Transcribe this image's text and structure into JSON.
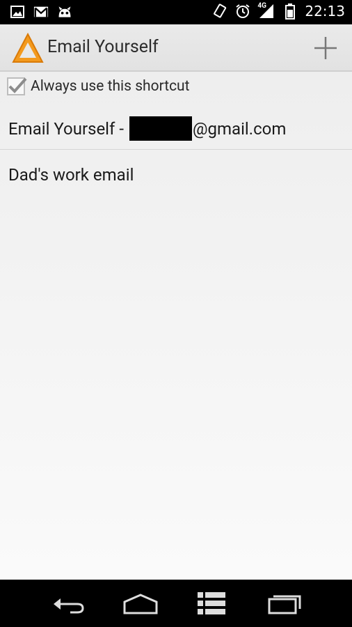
{
  "status_bar": {
    "time": "22:13",
    "network_label": "4G",
    "icons": [
      "image-icon",
      "gmail-icon",
      "cyanogen-icon",
      "rotate-icon",
      "alarm-icon",
      "signal-icon",
      "battery-icon"
    ]
  },
  "action_bar": {
    "title": "Email Yourself",
    "add_icon": "plus-icon"
  },
  "content": {
    "always_use_label": "Always use this shortcut",
    "always_use_checked": true,
    "items": [
      {
        "prefix": "Email Yourself -",
        "suffix": "@gmail.com"
      },
      {
        "label": "Dad's work email"
      }
    ]
  },
  "nav_bar": {
    "icons": [
      "back-icon",
      "home-icon",
      "menu-icon",
      "recents-icon"
    ]
  },
  "colors": {
    "logo_orange": "#f39a1e",
    "text_dark": "#1a1a1a"
  }
}
